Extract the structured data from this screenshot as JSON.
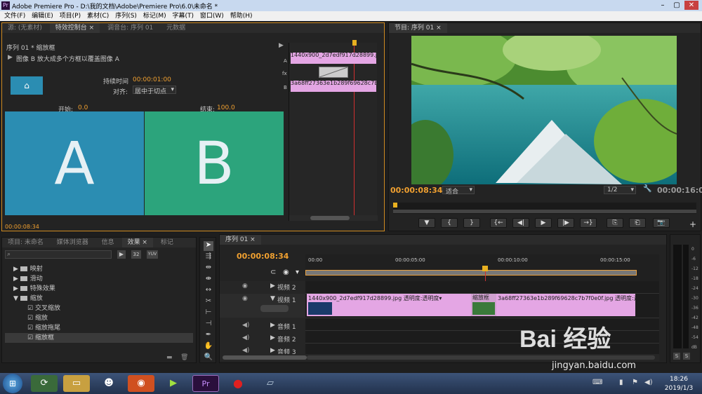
{
  "window": {
    "app_icon": "Pr",
    "title": "Adobe Premiere Pro - D:\\我的文档\\Adobe\\Premiere Pro\\6.0\\未命名 *"
  },
  "menu": [
    "文件(F)",
    "编辑(E)",
    "项目(P)",
    "素材(C)",
    "序列(S)",
    "标记(M)",
    "字幕(T)",
    "窗口(W)",
    "帮助(H)"
  ],
  "source_panel": {
    "tabs": [
      "源: (无素材)",
      "特效控制台 ×",
      "调音台: 序列 01",
      "元数据"
    ],
    "header": "序列 01 * 缩放框",
    "description": "图像 B 放大成多个方框以覆盖图像 A",
    "duration_label": "持续时间",
    "duration_value": "00:00:01:00",
    "align_label": "对齐:",
    "align_value": "居中于切点",
    "start_label": "开始:",
    "start_value": "0.0",
    "end_label": "结束:",
    "end_value": "100.0",
    "preview_a": "A",
    "preview_b": "B",
    "timecode": "00:00:08:34",
    "mini_track_a": "A",
    "mini_track_fx": "fx",
    "mini_track_b": "B",
    "mini_clip_a": "1440x900_2d7edf917d28899.jpg",
    "mini_clip_b": "3a68ff27363e1b289f69628c7b7f0e0f.jpg"
  },
  "program_panel": {
    "tab": "节目: 序列 01 ×",
    "timecode": "00:00:08:34",
    "fit": "适合",
    "quality": "1/2",
    "duration": "00:00:16:00",
    "controls": [
      "▼",
      "{",
      "}",
      "{←",
      "◀|",
      "▶",
      "|▶",
      "→}",
      "⎘",
      "⎗",
      "📷"
    ],
    "add_icon": "+"
  },
  "project_panel": {
    "tabs": [
      "项目: 未命名",
      "媒体浏览器",
      "信息",
      "效果 ×",
      "标记"
    ],
    "search_placeholder": "",
    "filter_labels": [
      "32",
      "YUV"
    ],
    "tree": [
      {
        "label": "映射",
        "depth": 1,
        "type": "folder"
      },
      {
        "label": "滑动",
        "depth": 1,
        "type": "folder"
      },
      {
        "label": "特殊效果",
        "depth": 1,
        "type": "folder"
      },
      {
        "label": "缩放",
        "depth": 1,
        "type": "folder-open"
      },
      {
        "label": "交叉缩放",
        "depth": 2,
        "type": "effect"
      },
      {
        "label": "缩放",
        "depth": 2,
        "type": "effect"
      },
      {
        "label": "缩放拖尾",
        "depth": 2,
        "type": "effect"
      },
      {
        "label": "缩放框",
        "depth": 2,
        "type": "effect",
        "selected": true
      }
    ]
  },
  "timeline": {
    "tab": "序列 01 ×",
    "timecode": "00:00:08:34",
    "ruler": [
      "00:00",
      "00:00:05:00",
      "00:00:10:00",
      "00:00:15:00"
    ],
    "tracks": [
      {
        "name": "视频 2",
        "type": "video"
      },
      {
        "name": "视频 1",
        "type": "video"
      },
      {
        "name": "音频 1",
        "type": "audio"
      },
      {
        "name": "音频 2",
        "type": "audio"
      },
      {
        "name": "音频 3",
        "type": "audio"
      }
    ],
    "clips": [
      {
        "label": "1440x900_2d7edf917d28899.jpg  透明度:透明度▾"
      },
      {
        "label": "缩放框"
      },
      {
        "label": "3a68ff27363e1b289f69628c7b7f0e0f.jpg  透明度:透明度▾"
      }
    ]
  },
  "meter": {
    "labels": [
      "0",
      "-6",
      "-12",
      "-18",
      "-24",
      "-30",
      "-36",
      "-42",
      "-48",
      "-54",
      "dB"
    ],
    "solo": [
      "S",
      "S"
    ]
  },
  "taskbar": {
    "time": "18:26",
    "date": "2019/1/3"
  },
  "watermark": {
    "brand": "Bai 经验",
    "url": "jingyan.baidu.com"
  }
}
